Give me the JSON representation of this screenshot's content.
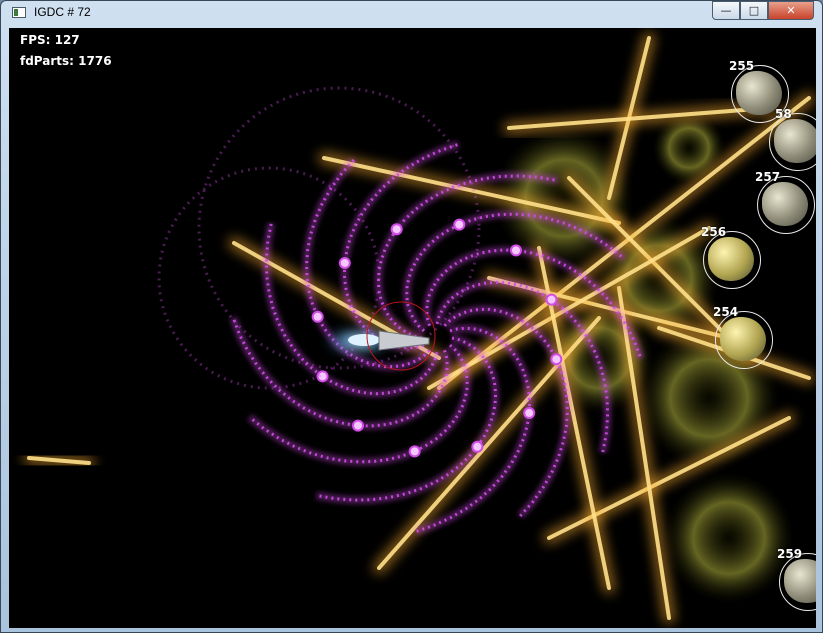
{
  "window": {
    "title": "IGDC # 72",
    "icon": "app-window-icon",
    "controls": {
      "minimize_icon": "minimize-icon",
      "maximize_icon": "maximize-icon",
      "close_icon": "close-icon"
    }
  },
  "hud": {
    "fps_text": "FPS: 127",
    "parts_text": "fdParts: 1776"
  },
  "enemies": [
    {
      "hp": "255"
    },
    {
      "hp": "58"
    },
    {
      "hp": "257"
    },
    {
      "hp": "256"
    },
    {
      "hp": "254"
    },
    {
      "hp": "259"
    }
  ],
  "colors": {
    "background": "#000000",
    "particle_magenta": "#d24ce8",
    "particle_orange": "#ffb030",
    "blast_yellow": "#d2d24a",
    "player_glow": "#5ab8ff"
  }
}
